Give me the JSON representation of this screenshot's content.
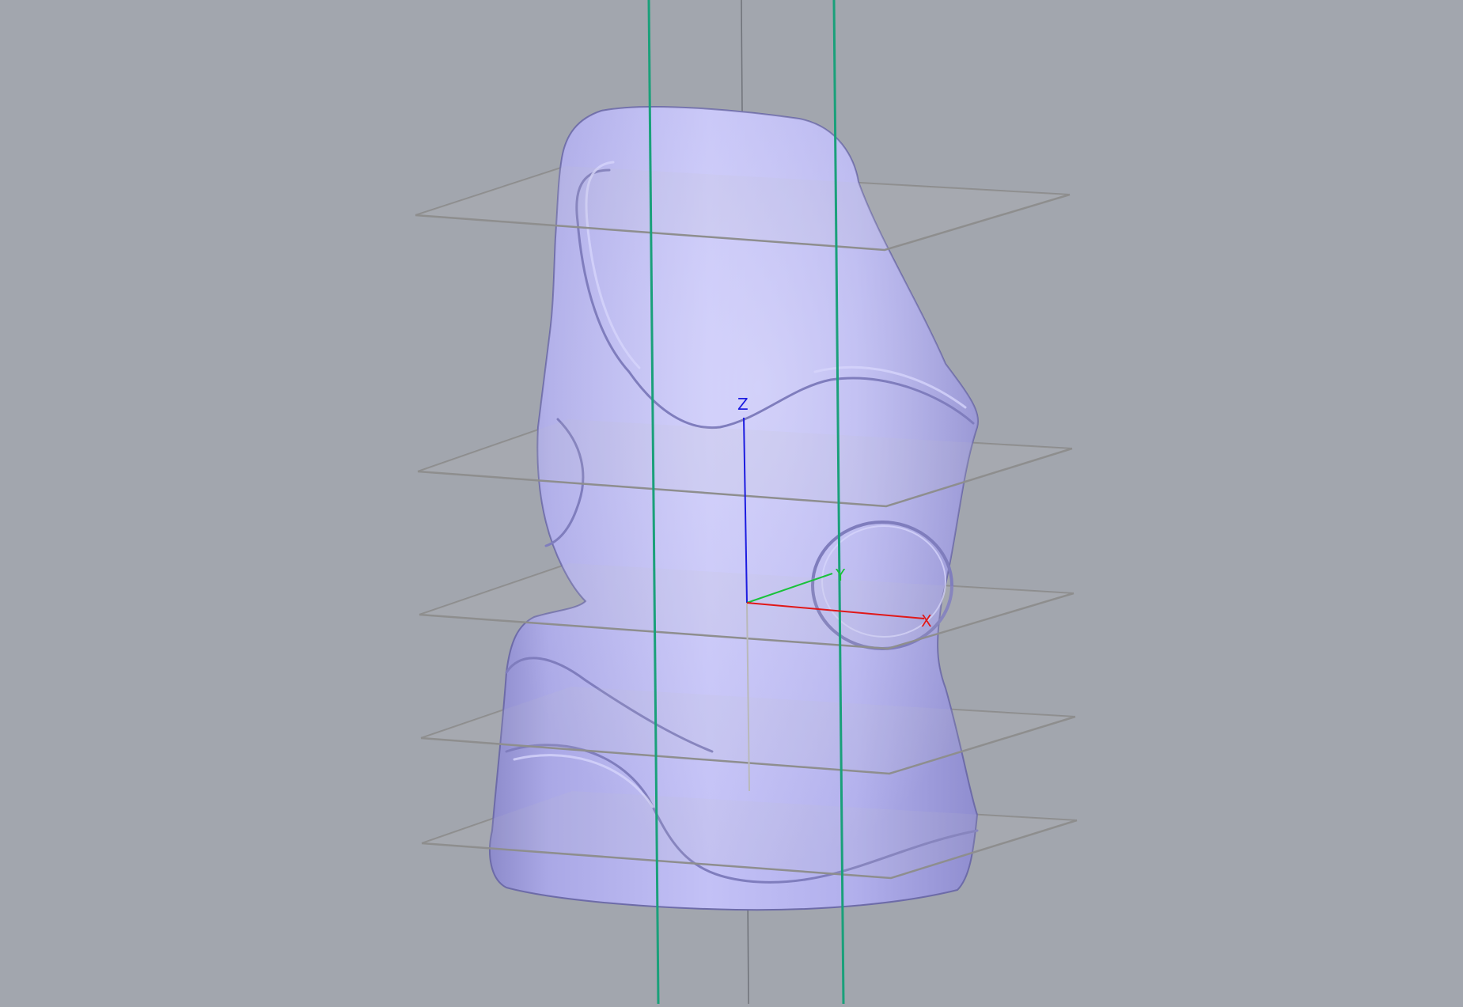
{
  "viewport": {
    "background": "#a2a6ae",
    "model_color": "#b3b1eb",
    "guide_line_color": "#1aa07a",
    "section_plane_color": "#8e8e8e"
  },
  "axes": {
    "x": {
      "label": "X",
      "color": "#e01818"
    },
    "y": {
      "label": "Y",
      "color": "#19c23a"
    },
    "z": {
      "label": "Z",
      "color": "#1c1ce0"
    }
  },
  "section_planes": {
    "count": 5
  },
  "guide_lines": {
    "count": 2
  }
}
